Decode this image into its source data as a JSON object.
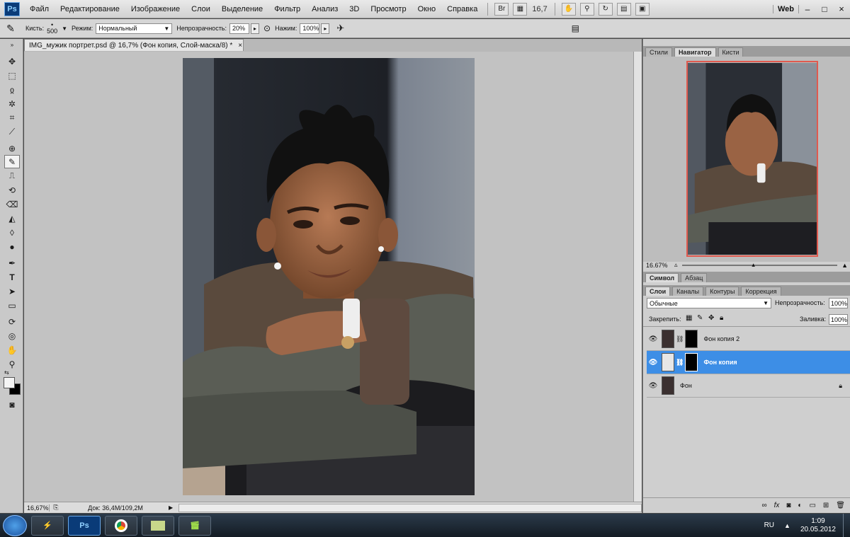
{
  "app": {
    "logo": "Ps"
  },
  "menu": [
    "Файл",
    "Редактирование",
    "Изображение",
    "Слои",
    "Выделение",
    "Фильтр",
    "Анализ",
    "3D",
    "Просмотр",
    "Окно",
    "Справка"
  ],
  "menubar_right": {
    "zoom": "16,7",
    "workspace": "Web",
    "bridge": "Br",
    "min": "–",
    "max": "□",
    "close": "×"
  },
  "options": {
    "brush_label": "Кисть:",
    "brush_size": "500",
    "mode_label": "Режим:",
    "mode_value": "Нормальный",
    "opacity_label": "Непрозрачность:",
    "opacity_value": "20%",
    "flow_label": "Нажим:",
    "flow_value": "100%"
  },
  "document": {
    "tab_title": "IMG_мужик портрет.psd @ 16,7% (Фон копия, Слой-маска/8) *",
    "tab_close": "×"
  },
  "status": {
    "zoom": "16,67%",
    "doc": "Док: 36,4M/109,2M"
  },
  "panels": {
    "top_tabs": [
      "Стили",
      "Навигатор",
      "Кисти"
    ],
    "top_active": 1,
    "nav_zoom": "16.67%",
    "char_tabs": [
      "Символ",
      "Абзац"
    ],
    "layer_tabs": [
      "Слои",
      "Каналы",
      "Контуры",
      "Коррекция"
    ],
    "blend_mode": "Обычные",
    "opacity_label": "Непрозрачность:",
    "opacity_value": "100%",
    "lock_label": "Закрепить:",
    "fill_label": "Заливка:",
    "fill_value": "100%",
    "layers": [
      {
        "name": "Фон копия 2"
      },
      {
        "name": "Фон копия"
      },
      {
        "name": "Фон"
      }
    ]
  },
  "taskbar": {
    "ps_label": "Ps",
    "lang": "RU",
    "time": "1:09",
    "date": "20.05.2012"
  }
}
